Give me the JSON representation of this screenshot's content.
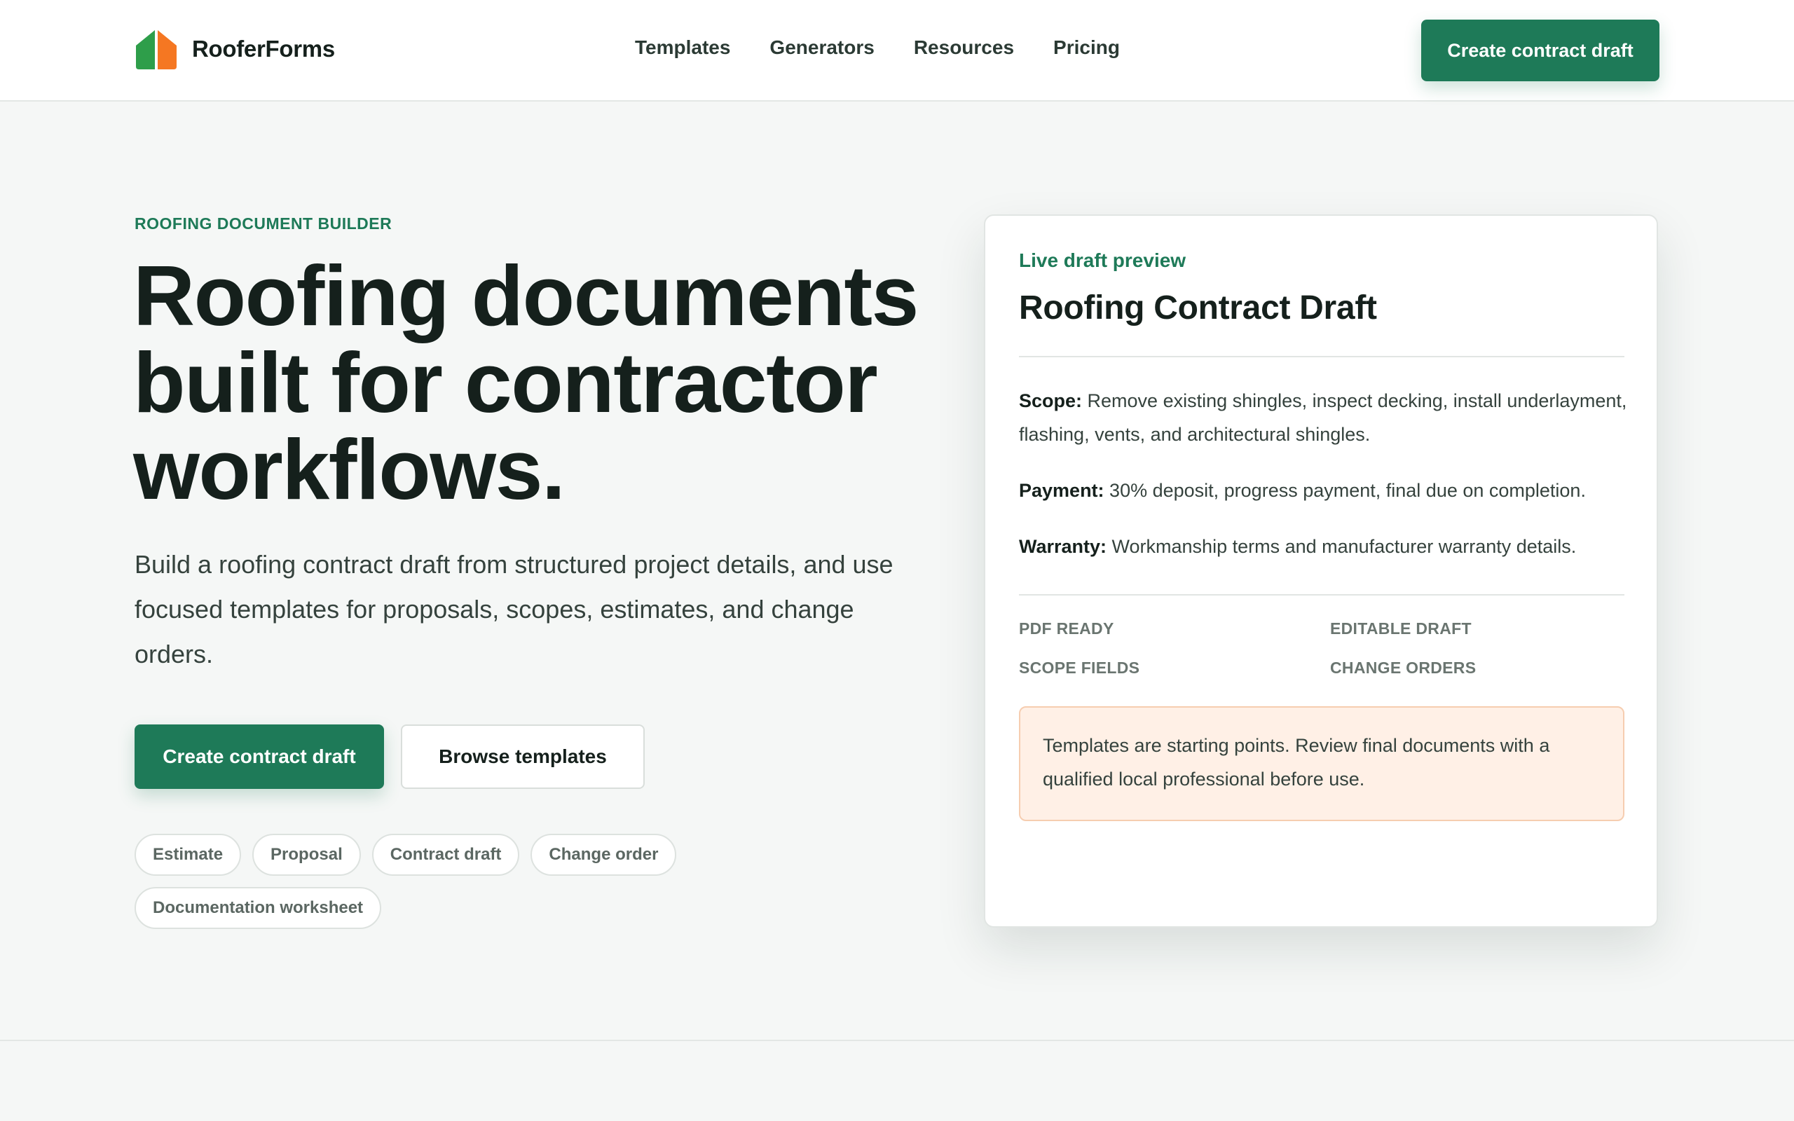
{
  "brand": {
    "name": "RooferForms"
  },
  "nav": {
    "items": [
      "Templates",
      "Generators",
      "Resources",
      "Pricing"
    ]
  },
  "header": {
    "cta_label": "Create contract draft"
  },
  "hero": {
    "eyebrow": "ROOFING DOCUMENT BUILDER",
    "title": "Roofing documents built for contractor workflows.",
    "subtitle": "Build a roofing contract draft from structured project details, and use focused templates for proposals, scopes, estimates, and change orders.",
    "primary_cta": "Create contract draft",
    "secondary_cta": "Browse templates",
    "chips": [
      "Estimate",
      "Proposal",
      "Contract draft",
      "Change order",
      "Documentation worksheet"
    ]
  },
  "preview": {
    "eyebrow": "Live draft preview",
    "title": "Roofing Contract Draft",
    "terms": [
      {
        "label": "Scope:",
        "text": " Remove existing shingles, inspect decking, install underlayment, flashing, vents, and architectural shingles."
      },
      {
        "label": "Payment:",
        "text": " 30% deposit, progress payment, final due on completion."
      },
      {
        "label": "Warranty:",
        "text": " Workmanship terms and manufacturer warranty details."
      }
    ],
    "features": [
      "PDF READY",
      "EDITABLE DRAFT",
      "SCOPE FIELDS",
      "CHANGE ORDERS"
    ],
    "notice": "Templates are starting points. Review final documents with a qualified local professional before use."
  },
  "colors": {
    "accent": "#1e7a58",
    "logo_left": "#2e9e4a",
    "logo_right": "#f57722",
    "notice_bg": "#fff0e6",
    "page_bg": "#f5f7f6"
  },
  "icons": {
    "logo": "house-logo-icon"
  }
}
